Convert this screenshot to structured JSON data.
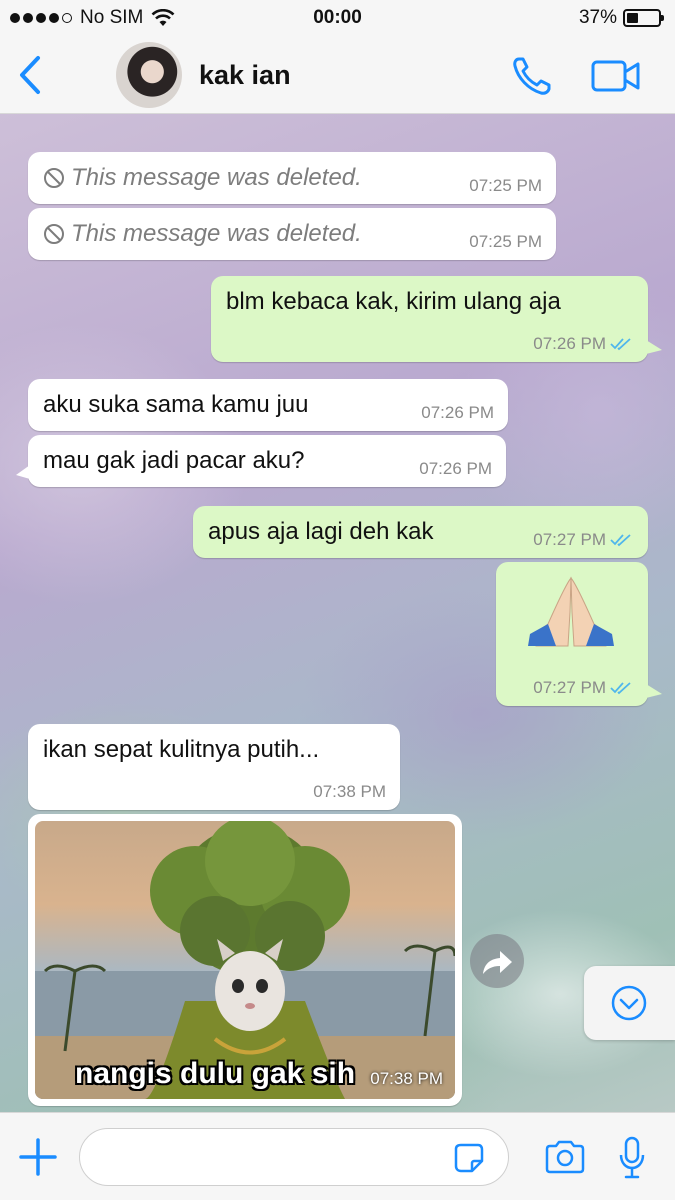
{
  "status_bar": {
    "carrier": "No SIM",
    "time": "00:00",
    "battery": "37%",
    "battery_level": 0.37
  },
  "header": {
    "contact_name": "kak ian",
    "back_icon": "chevron-left-icon",
    "call_icon": "phone-icon",
    "video_icon": "video-camera-icon"
  },
  "messages": [
    {
      "dir": "in",
      "deleted": true,
      "text": "This message was deleted.",
      "time": "07:25 PM"
    },
    {
      "dir": "in",
      "deleted": true,
      "text": "This message was deleted.",
      "time": "07:25 PM"
    },
    {
      "dir": "out",
      "text": "blm kebaca kak, kirim ulang aja",
      "time": "07:26 PM",
      "read": true
    },
    {
      "dir": "in",
      "text": "aku suka sama kamu juu",
      "time": "07:26 PM"
    },
    {
      "dir": "in",
      "text": "mau gak jadi pacar aku?",
      "time": "07:26 PM"
    },
    {
      "dir": "out",
      "text": "apus aja lagi deh kak",
      "time": "07:27 PM",
      "read": true
    },
    {
      "dir": "out",
      "text": "🙏🏻",
      "time": "07:27 PM",
      "read": true
    },
    {
      "dir": "in",
      "text": "ikan sepat kulitnya putih...",
      "time": "07:38 PM"
    },
    {
      "dir": "in",
      "image": true,
      "caption": "nangis dulu gak sih",
      "time": "07:38 PM"
    }
  ],
  "input": {
    "placeholder": "",
    "icons": [
      "plus-icon",
      "sticker-icon",
      "camera-icon",
      "microphone-icon"
    ]
  },
  "colors": {
    "accent": "#1a8cff",
    "outgoing_bubble": "#dcf8c6",
    "incoming_bubble": "#ffffff",
    "read_ticks": "#4fb6ec"
  }
}
